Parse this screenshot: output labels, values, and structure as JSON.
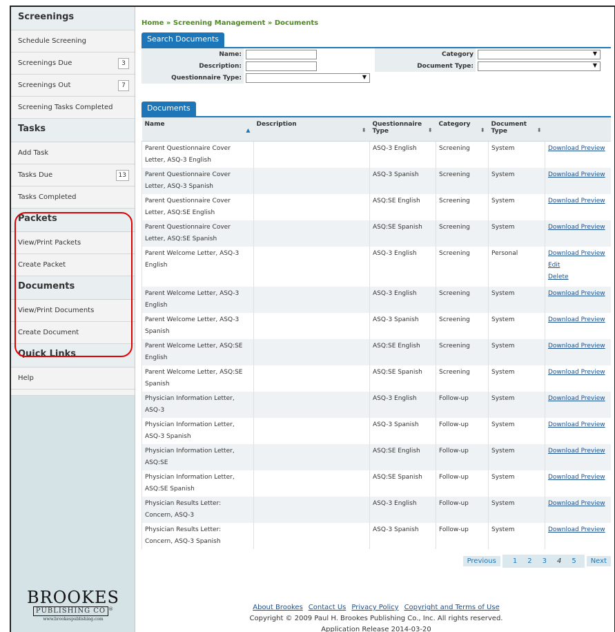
{
  "sidebar": {
    "sections": [
      {
        "title": "Screenings",
        "items": [
          {
            "label": "Schedule Screening",
            "badge": ""
          },
          {
            "label": "Screenings Due",
            "badge": "3"
          },
          {
            "label": "Screenings Out",
            "badge": "7"
          },
          {
            "label": "Screening Tasks Completed",
            "badge": ""
          }
        ]
      },
      {
        "title": "Tasks",
        "items": [
          {
            "label": "Add Task",
            "badge": ""
          },
          {
            "label": "Tasks Due",
            "badge": "13"
          },
          {
            "label": "Tasks Completed",
            "badge": ""
          }
        ]
      },
      {
        "title": "Packets",
        "items": [
          {
            "label": "View/Print Packets",
            "badge": ""
          },
          {
            "label": "Create Packet",
            "badge": ""
          }
        ]
      },
      {
        "title": "Documents",
        "items": [
          {
            "label": "View/Print Documents",
            "badge": ""
          },
          {
            "label": "Create Document",
            "badge": ""
          }
        ]
      },
      {
        "title": "Quick Links",
        "items": [
          {
            "label": "Help",
            "badge": ""
          }
        ]
      }
    ],
    "logo": {
      "brand": "BROOKES",
      "publishing": "PUBLISHING CO",
      "url": "www.brookespublishing.com"
    }
  },
  "breadcrumb": "Home » Screening Management » Documents",
  "search": {
    "tab": "Search Documents",
    "name_label": "Name:",
    "description_label": "Description:",
    "questionnaire_label": "Questionnaire Type:",
    "category_label": "Category",
    "doctype_label": "Document Type:",
    "name_value": "",
    "description_value": "",
    "questionnaire_value": "",
    "category_value": "",
    "doctype_value": ""
  },
  "documents": {
    "tab": "Documents",
    "columns": [
      "Name",
      "Description",
      "Questionnaire Type",
      "Category",
      "Document Type"
    ],
    "rows": [
      {
        "name": "Parent Questionnaire Cover Letter, ASQ-3 English",
        "desc": "",
        "qt": "ASQ-3 English",
        "cat": "Screening",
        "type": "System",
        "actions": [
          "Download Preview"
        ]
      },
      {
        "name": "Parent Questionnaire Cover Letter, ASQ-3 Spanish",
        "desc": "",
        "qt": "ASQ-3 Spanish",
        "cat": "Screening",
        "type": "System",
        "actions": [
          "Download Preview"
        ]
      },
      {
        "name": "Parent Questionnaire Cover Letter, ASQ:SE English",
        "desc": "",
        "qt": "ASQ:SE English",
        "cat": "Screening",
        "type": "System",
        "actions": [
          "Download Preview"
        ]
      },
      {
        "name": "Parent Questionnaire Cover Letter, ASQ:SE Spanish",
        "desc": "",
        "qt": "ASQ:SE Spanish",
        "cat": "Screening",
        "type": "System",
        "actions": [
          "Download Preview"
        ]
      },
      {
        "name": "Parent Welcome Letter, ASQ-3 English",
        "desc": "",
        "qt": "ASQ-3 English",
        "cat": "Screening",
        "type": "Personal",
        "actions": [
          "Download Preview",
          "Edit",
          "Delete"
        ]
      },
      {
        "name": "Parent Welcome Letter, ASQ-3 English",
        "desc": "",
        "qt": "ASQ-3 English",
        "cat": "Screening",
        "type": "System",
        "actions": [
          "Download Preview"
        ]
      },
      {
        "name": "Parent Welcome Letter, ASQ-3 Spanish",
        "desc": "",
        "qt": "ASQ-3 Spanish",
        "cat": "Screening",
        "type": "System",
        "actions": [
          "Download Preview"
        ]
      },
      {
        "name": "Parent Welcome Letter, ASQ:SE English",
        "desc": "",
        "qt": "ASQ:SE English",
        "cat": "Screening",
        "type": "System",
        "actions": [
          "Download Preview"
        ]
      },
      {
        "name": "Parent Welcome Letter, ASQ:SE Spanish",
        "desc": "",
        "qt": "ASQ:SE Spanish",
        "cat": "Screening",
        "type": "System",
        "actions": [
          "Download Preview"
        ]
      },
      {
        "name": "Physician Information Letter, ASQ-3",
        "desc": "",
        "qt": "ASQ-3 English",
        "cat": "Follow-up",
        "type": "System",
        "actions": [
          "Download Preview"
        ]
      },
      {
        "name": "Physician Information Letter, ASQ-3 Spanish",
        "desc": "",
        "qt": "ASQ-3 Spanish",
        "cat": "Follow-up",
        "type": "System",
        "actions": [
          "Download Preview"
        ]
      },
      {
        "name": "Physician Information Letter, ASQ:SE",
        "desc": "",
        "qt": "ASQ:SE English",
        "cat": "Follow-up",
        "type": "System",
        "actions": [
          "Download Preview"
        ]
      },
      {
        "name": "Physician Information Letter, ASQ:SE Spanish",
        "desc": "",
        "qt": "ASQ:SE Spanish",
        "cat": "Follow-up",
        "type": "System",
        "actions": [
          "Download Preview"
        ]
      },
      {
        "name": "Physician Results Letter: Concern, ASQ-3",
        "desc": "",
        "qt": "ASQ-3 English",
        "cat": "Follow-up",
        "type": "System",
        "actions": [
          "Download Preview"
        ]
      },
      {
        "name": "Physician Results Letter: Concern, ASQ-3 Spanish",
        "desc": "",
        "qt": "ASQ-3 Spanish",
        "cat": "Follow-up",
        "type": "System",
        "actions": [
          "Download Preview"
        ]
      }
    ]
  },
  "pager": {
    "previous": "Previous",
    "pages": [
      "1",
      "2",
      "3",
      "4",
      "5"
    ],
    "current": "4",
    "next": "Next"
  },
  "footer": {
    "links": [
      "About Brookes",
      "Contact Us",
      "Privacy Policy",
      "Copyright and Terms of Use"
    ],
    "copyright": "Copyright © 2009 Paul H. Brookes Publishing Co., Inc. All rights reserved.",
    "release": "Application Release 2014-03-20"
  }
}
